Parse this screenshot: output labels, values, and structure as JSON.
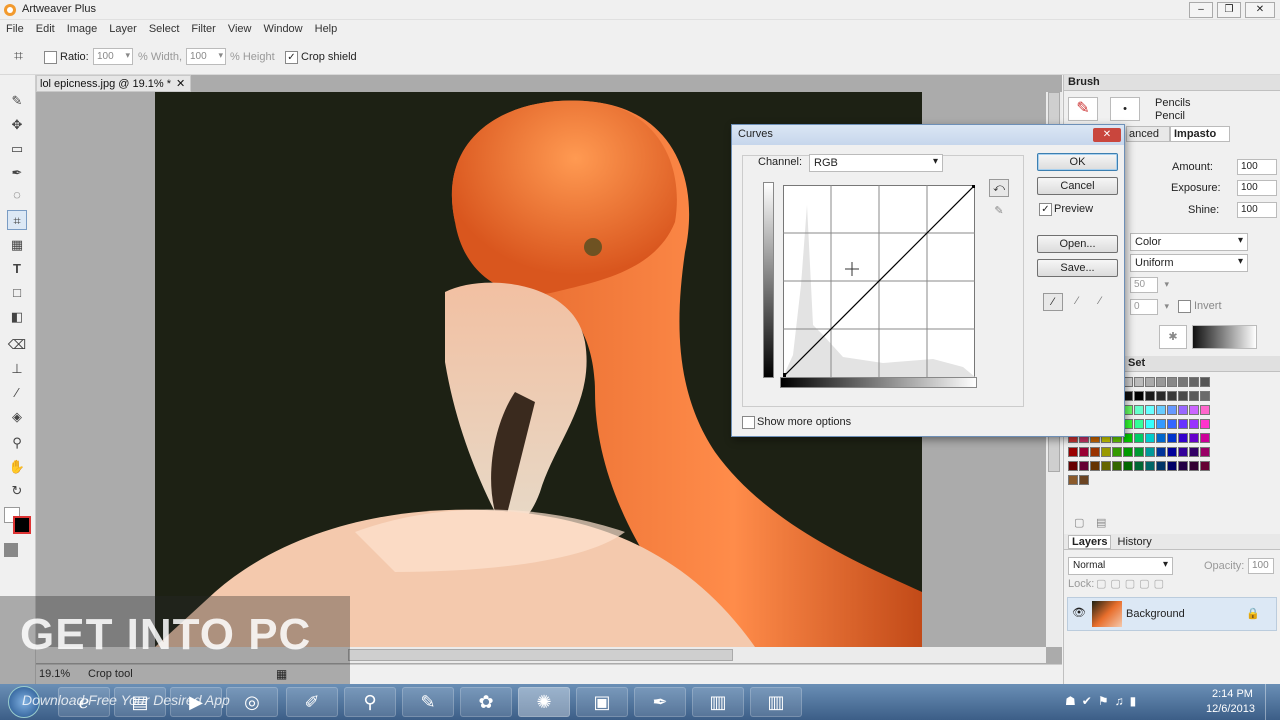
{
  "app": {
    "title": "Artweaver Plus"
  },
  "menu": [
    "File",
    "Edit",
    "Image",
    "Layer",
    "Select",
    "Filter",
    "View",
    "Window",
    "Help"
  ],
  "options": {
    "ratio_label": "Ratio:",
    "width_value": "100",
    "width_label": "% Width,",
    "height_value": "100",
    "height_label": "% Height",
    "crop_shield_label": "Crop shield"
  },
  "document": {
    "tab_title": "lol epicness.jpg @ 19.1% *",
    "close": "✕"
  },
  "status": {
    "zoom": "19.1%",
    "tool": "Crop tool"
  },
  "curves": {
    "title": "Curves",
    "channel_label": "Channel:",
    "channel_value": "RGB",
    "ok": "OK",
    "cancel": "Cancel",
    "preview_label": "Preview",
    "open": "Open...",
    "save": "Save...",
    "show_more": "Show more options"
  },
  "brush": {
    "panel_title": "Brush",
    "category": "Pencils",
    "variant": "Pencil",
    "tabs": [
      "Advanced",
      "Impasto"
    ],
    "tab_partial": "anced",
    "amount_label": "Amount:",
    "amount": "100",
    "exposure_label": "Exposure:",
    "exposure": "100",
    "shine_label": "Shine:",
    "shine": "100",
    "color_mode": "Color",
    "texture_mode": "Uniform",
    "v1": "50",
    "v2": "0",
    "invert_label": "Invert"
  },
  "swatches": {
    "panel_title": "Set"
  },
  "layers": {
    "tabs": [
      "Layers",
      "History"
    ],
    "blend": "Normal",
    "opacity_label": "Opacity:",
    "opacity": "100",
    "lock_label": "Lock:",
    "layer_name": "Background"
  },
  "watermark": {
    "main": "GET INTO PC",
    "sub": "Download Free Your Desired App"
  },
  "clock": {
    "time": "2:14 PM",
    "date": "12/6/2013"
  },
  "colors": {
    "accent": "#3c5e87",
    "dialog_border": "#6d8fb7"
  }
}
